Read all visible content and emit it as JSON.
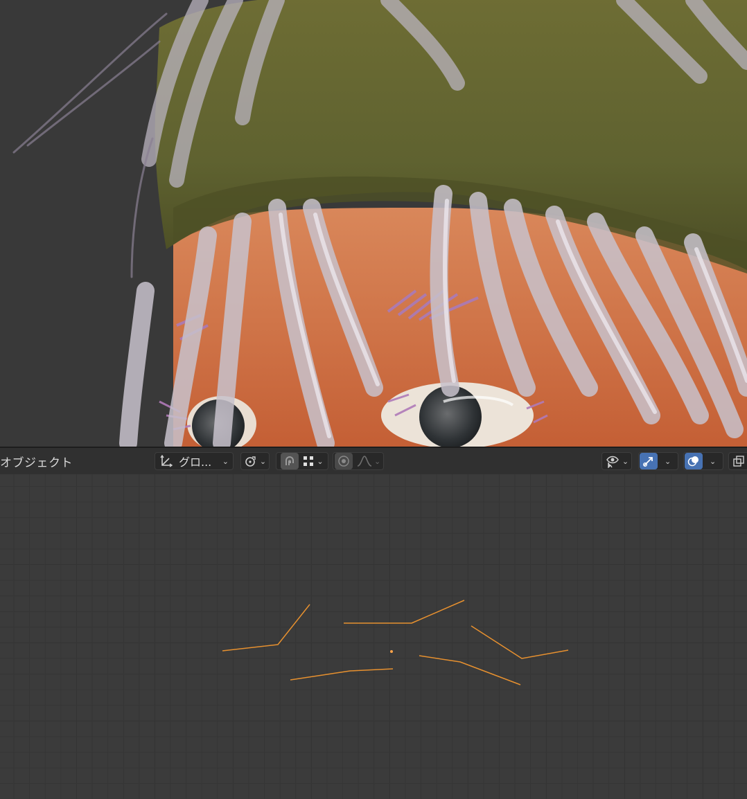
{
  "header": {
    "mode_label": "オブジェクト",
    "transform_orientation": "グロ...",
    "icons": {
      "orientation": "orientation-axes-icon",
      "pivot": "pivot-point-icon",
      "snap": "magnet-snap-icon",
      "snap_target": "snap-grid-icon",
      "proportional": "proportional-edit-icon",
      "falloff": "falloff-curve-icon",
      "visibility": "eye-selectability-icon",
      "gizmo": "gizmo-arrow-icon",
      "overlay": "overlay-circles-icon",
      "xray": "xray-toggle-icon"
    }
  },
  "colors": {
    "accent": "#4772b3",
    "curve": "#e8912f",
    "background": "#303030"
  }
}
